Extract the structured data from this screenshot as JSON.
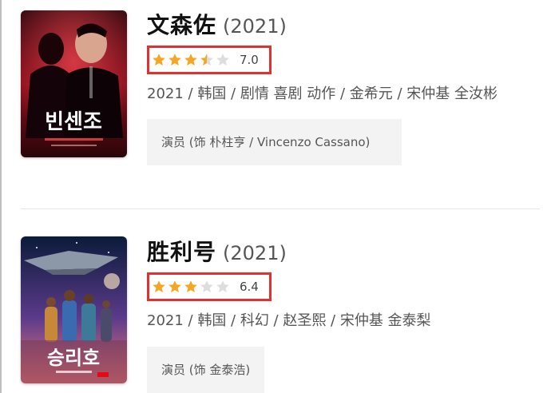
{
  "colors": {
    "star_on": "#f5a623",
    "star_off": "#dddddd",
    "highlight_border": "#e03030"
  },
  "movies": [
    {
      "title": "文森佐",
      "year": "(2021)",
      "rating_stars": 3.5,
      "rating_max_stars": 5,
      "score": "7.0",
      "meta": "2021 / 韩国 / 剧情 喜剧 动作 / 金希元 / 宋仲基 全汝彬",
      "cast": "演员 (饰 朴柱亨 / Vincenzo Cassano)",
      "poster_text": "빈센조"
    },
    {
      "title": "胜利号",
      "year": "(2021)",
      "rating_stars": 3,
      "rating_max_stars": 5,
      "score": "6.4",
      "meta": "2021 / 韩国 / 科幻 / 赵圣熙 / 宋仲基 金泰梨",
      "cast": "演员 (饰 金泰浩)",
      "poster_text": "승리호"
    }
  ]
}
